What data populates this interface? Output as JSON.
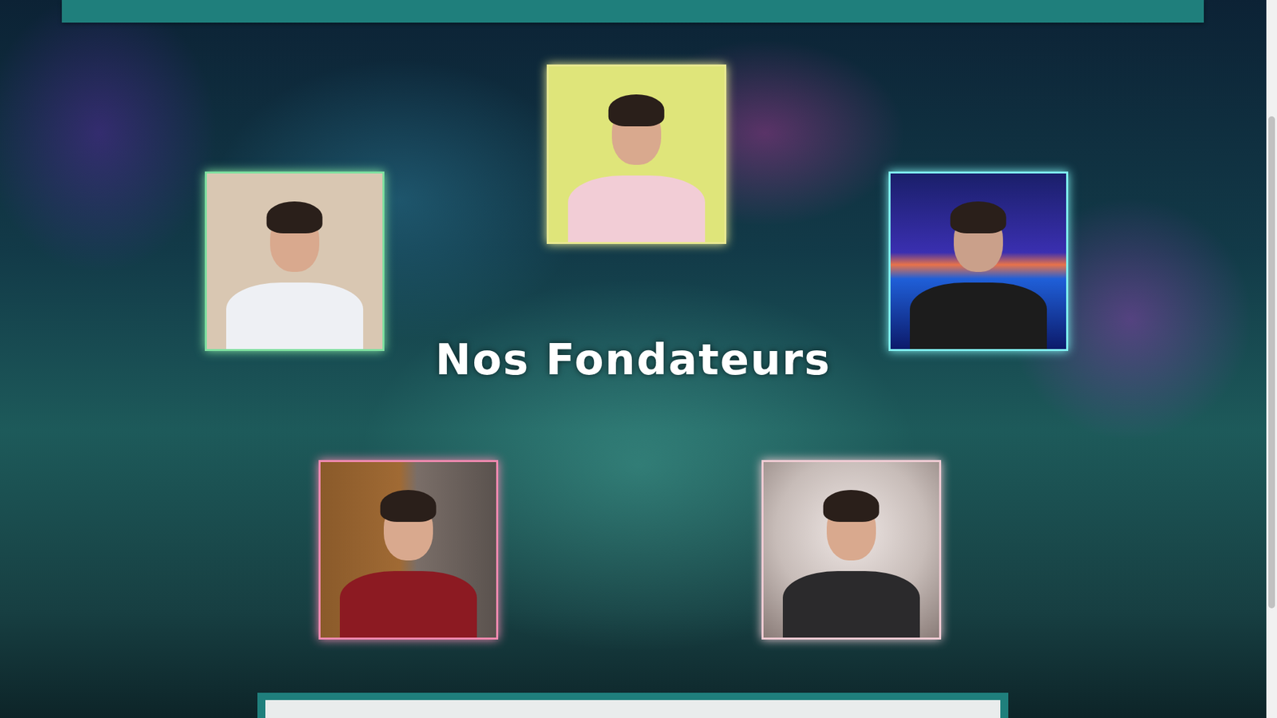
{
  "section": {
    "title": "Nos Fondateurs"
  },
  "founders": [
    {
      "color": "#e8e890"
    },
    {
      "color": "#7fe0a0"
    },
    {
      "color": "#7ff0f0"
    },
    {
      "color": "#f08ab0"
    },
    {
      "color": "#f0ccd4"
    }
  ]
}
